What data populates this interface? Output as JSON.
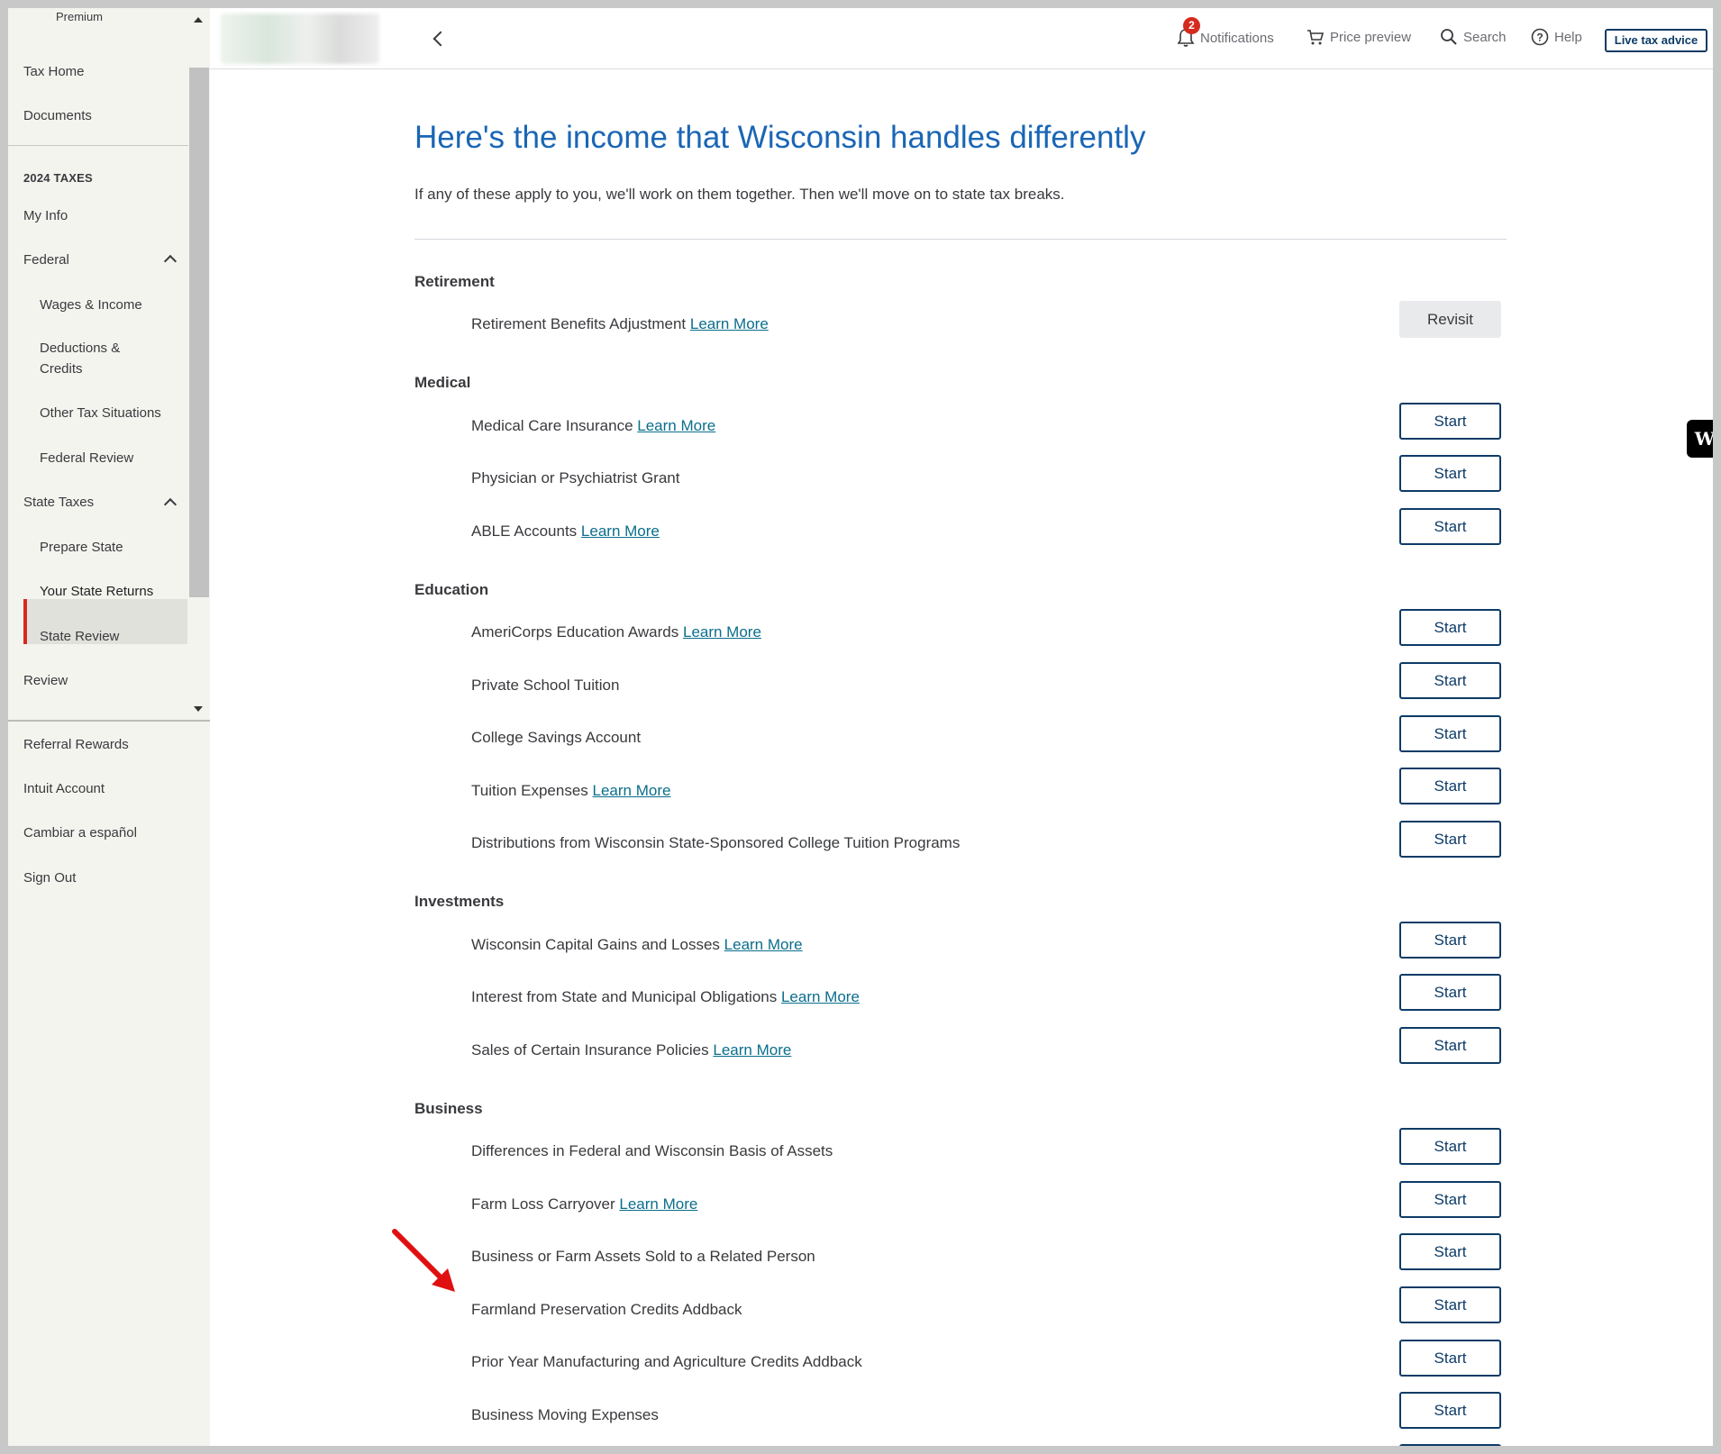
{
  "sidebar": {
    "plan": "Premium",
    "top_items": [
      "Tax Home",
      "Documents"
    ],
    "section_heading": "2024 TAXES",
    "my_info": "My Info",
    "federal": "Federal",
    "federal_items": [
      "Wages & Income",
      "Deductions & Credits",
      "Other Tax Situations",
      "Federal Review"
    ],
    "state": "State Taxes",
    "state_items": [
      "Prepare State",
      "Your State Returns",
      "State Review"
    ],
    "review": "Review",
    "bottom_items": [
      "Referral Rewards",
      "Intuit Account",
      "Cambiar a español",
      "Sign Out"
    ]
  },
  "topbar": {
    "notifications": "Notifications",
    "notification_count": "2",
    "price_preview": "Price preview",
    "search": "Search",
    "help": "Help",
    "live_advice": "Live tax advice"
  },
  "main": {
    "title": "Here's the income that Wisconsin handles differently",
    "subtitle": "If any of these apply to you, we'll work on them together. Then we'll move on to state tax breaks.",
    "learn_more": "Learn More",
    "start": "Start",
    "revisit": "Revisit",
    "sections": {
      "retirement": "Retirement",
      "medical": "Medical",
      "education": "Education",
      "investments": "Investments",
      "business": "Business"
    },
    "rows": {
      "retirement_benefits": "Retirement Benefits Adjustment",
      "medical_care_insurance": "Medical Care Insurance",
      "physician_grant": "Physician or Psychiatrist Grant",
      "able_accounts": "ABLE Accounts",
      "americorps": "AmeriCorps Education Awards",
      "private_school": "Private School Tuition",
      "college_savings": "College Savings Account",
      "tuition_expenses": "Tuition Expenses",
      "wi_distributions": "Distributions from Wisconsin State-Sponsored College Tuition Programs",
      "capital_gains": "Wisconsin Capital Gains and Losses",
      "interest_obligations": "Interest from State and Municipal Obligations",
      "insurance_policies": "Sales of Certain Insurance Policies",
      "basis_of_assets": "Differences in Federal and Wisconsin Basis of Assets",
      "farm_loss": "Farm Loss Carryover",
      "assets_related_person": "Business or Farm Assets Sold to a Related Person",
      "farmland_preservation": "Farmland Preservation Credits Addback",
      "prior_year_manufacturing": "Prior Year Manufacturing and Agriculture Credits Addback",
      "moving_expenses": "Business Moving Expenses"
    }
  },
  "colors": {
    "title_blue": "#1a66b5",
    "button_navy": "#0d3b66",
    "link_teal": "#0a6e8c",
    "active_red": "#d52b1e",
    "annotation_arrow": "#e01010"
  }
}
